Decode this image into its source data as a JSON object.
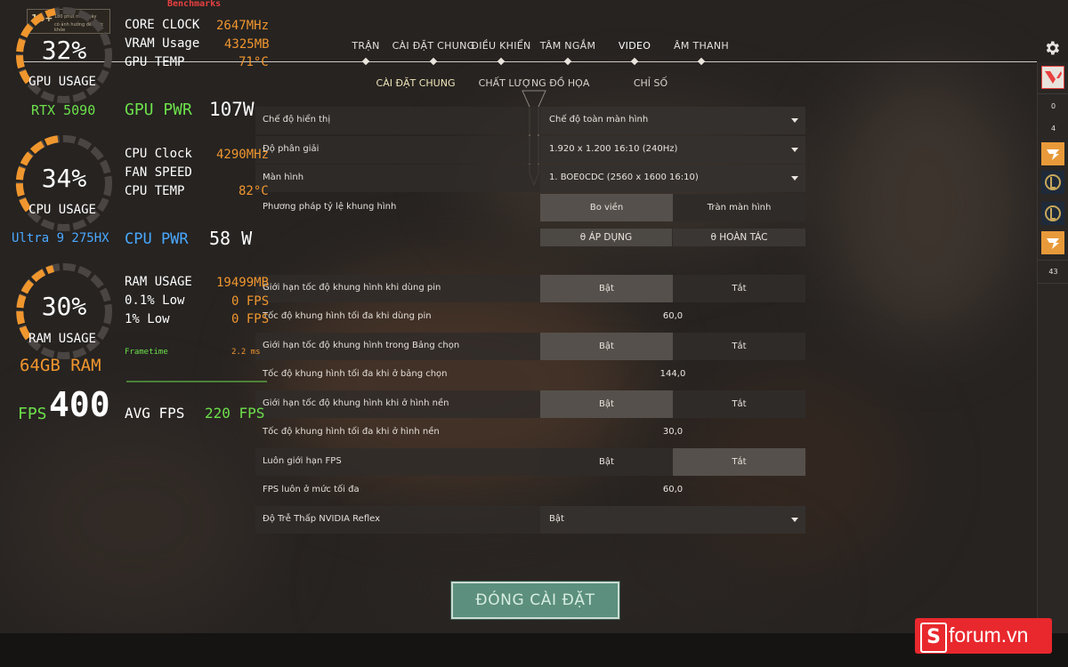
{
  "banner": {
    "badge": "18+",
    "line1": "180 phút mỗi ngày",
    "line2": "có ảnh hưởng đến sức khỏe"
  },
  "hud": {
    "title": "Benchmarks",
    "gpu": {
      "pct": "32%",
      "label": "GPU USAGE",
      "pct_value": 32,
      "model": "RTX 5090",
      "core_clock_label": "CORE CLOCK",
      "core_clock": "2647MHz",
      "vram_label": "VRAM Usage",
      "vram": "4325MB",
      "temp_label": "GPU TEMP",
      "temp": "71°C",
      "pwr_label": "GPU PWR",
      "pwr": "107W"
    },
    "cpu": {
      "pct": "34%",
      "label": "CPU USAGE",
      "pct_value": 34,
      "model": "Ultra 9 275HX",
      "clock_label": "CPU Clock",
      "clock": "4290MHz",
      "fan_label": "FAN SPEED",
      "fan": "",
      "temp_label": "CPU TEMP",
      "temp": "82°C",
      "pwr_label": "CPU PWR",
      "pwr": "58 W"
    },
    "ram": {
      "pct": "30%",
      "label": "RAM USAGE",
      "pct_value": 30,
      "size": "64GB RAM",
      "usage_label": "RAM USAGE",
      "usage": "19499MB",
      "low01_label": "0.1% Low",
      "low01": "0 FPS",
      "low1_label": "1% Low",
      "low1": "0 FPS"
    },
    "frametime_label": "Frametime",
    "frametime": "2.2 ms",
    "fps_label": "FPS",
    "fps": "400",
    "avg_fps_label": "AVG FPS",
    "avg_fps": "220 FPS"
  },
  "nav": {
    "tabs": [
      "TRẬN",
      "CÀI ĐẶT CHUNG",
      "ĐIỀU KHIỂN",
      "TÂM NGẮM",
      "VIDEO",
      "ÂM THANH"
    ],
    "active_tab": "VIDEO",
    "subtabs": [
      "CÀI ĐẶT CHUNG",
      "CHẤT LƯỢNG ĐỒ HỌA",
      "CHỈ SỐ"
    ],
    "active_subtab": "CÀI ĐẶT CHUNG",
    "settings_icon": "gear-icon"
  },
  "settings": {
    "display_mode": {
      "label": "Chế độ hiển thị",
      "value": "Chế độ toàn màn hình"
    },
    "resolution": {
      "label": "Độ phân giải",
      "value": "1.920 x 1.200 16:10 (240Hz)"
    },
    "monitor": {
      "label": "Màn hình",
      "value": "1. BOE0CDC (2560 x  1600 16:10)"
    },
    "aspect": {
      "label": "Phương pháp tỷ lệ khung hình",
      "opt1": "Bo viền",
      "opt2": "Tràn màn hình"
    },
    "apply": "ÁP DỤNG",
    "revert": "HOÀN TÁC",
    "limit_battery": {
      "label": "Giới hạn tốc độ khung hình khi dùng pin",
      "on": "Bật",
      "off": "Tắt"
    },
    "max_battery": {
      "label": "Tốc độ khung hình tối đa khi dùng pin",
      "value": "60,0"
    },
    "limit_menu": {
      "label": "Giới hạn tốc độ khung hình trong Bảng chọn",
      "on": "Bật",
      "off": "Tắt"
    },
    "max_menu": {
      "label": "Tốc độ khung hình tối đa khi ở bảng chọn",
      "value": "144,0"
    },
    "limit_bg": {
      "label": "Giới hạn tốc độ khung hình khi ở hình nền",
      "on": "Bật",
      "off": "Tắt"
    },
    "max_bg": {
      "label": "Tốc độ khung hình tối đa khi ở hình nền",
      "value": "30,0"
    },
    "always_limit": {
      "label": "Luôn giới hạn FPS",
      "on": "Bật",
      "off": "Tắt"
    },
    "fps_max": {
      "label": "FPS luôn ở mức tối đa",
      "value": "60,0"
    },
    "reflex": {
      "label": "Độ Trễ Thấp NVIDIA Reflex",
      "value": "Bật"
    }
  },
  "close_button": "ĐÓNG CÀI ĐẶT",
  "sidebar": {
    "counts": [
      "0",
      "4",
      "43"
    ]
  },
  "watermark": {
    "s": "S",
    "text": "forum.vn"
  },
  "colors": {
    "accent_green": "#6de04b",
    "accent_orange": "#f0962e",
    "accent_blue": "#4aa8ff",
    "close_button": "#5c8f7d",
    "brand_red": "#e8282d"
  }
}
